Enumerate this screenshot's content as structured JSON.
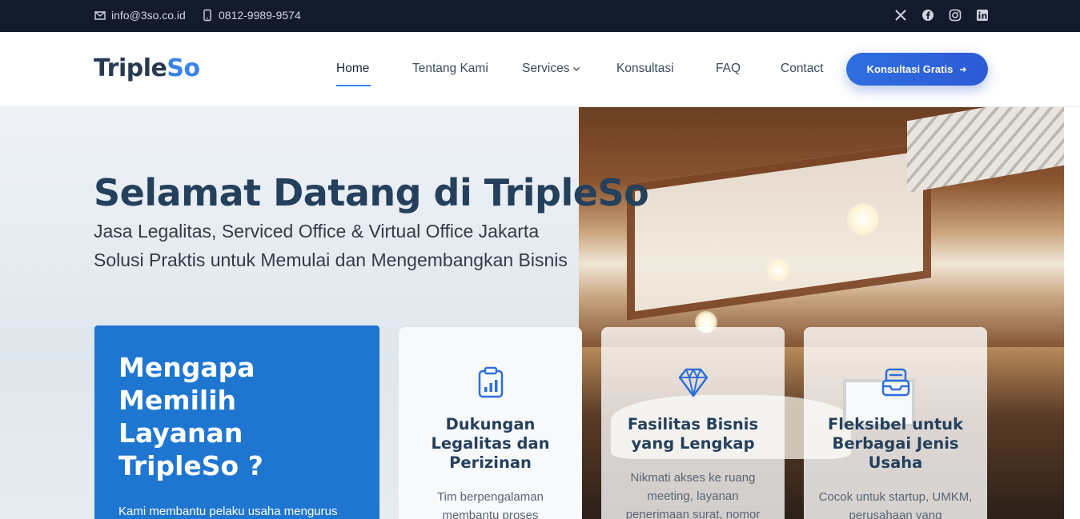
{
  "topbar": {
    "email": "info@3so.co.id",
    "phone": "0812-9989-9574",
    "social": [
      "x-icon",
      "facebook-icon",
      "instagram-icon",
      "linkedin-icon"
    ]
  },
  "header": {
    "logo_part1": "Triple",
    "logo_part2": "So",
    "nav": [
      {
        "label": "Home",
        "active": true
      },
      {
        "label": "Tentang Kami"
      },
      {
        "label": "Services",
        "dropdown": true
      },
      {
        "label": "Konsultasi"
      },
      {
        "label": "FAQ"
      },
      {
        "label": "Contact"
      }
    ],
    "cta_label": "Konsultasi Gratis",
    "accent_color": "#3b82e6"
  },
  "hero": {
    "title": "Selamat Datang di TripleSo",
    "subtitle1": "Jasa Legalitas, Serviced Office & Virtual Office Jakarta",
    "subtitle2": "Solusi Praktis untuk Memulai dan Mengembangkan Bisnis"
  },
  "why": {
    "title": "Mengapa Memilih Layanan TripleSo ?",
    "text": "Kami membantu pelaku usaha mengurus",
    "color": "#1f76d1"
  },
  "cards": [
    {
      "icon": "clipboard-chart-icon",
      "title": "Dukungan Legalitas dan Perizinan",
      "text": "Tim berpengalaman membantu proses"
    },
    {
      "icon": "diamond-icon",
      "title": "Fasilitas Bisnis yang Lengkap",
      "text": "Nikmati akses ke ruang meeting, layanan penerimaan surat, nomor"
    },
    {
      "icon": "inbox-icon",
      "title": "Fleksibel untuk Berbagai Jenis Usaha",
      "text": "Cocok untuk startup, UMKM, perusahaan yang"
    }
  ]
}
